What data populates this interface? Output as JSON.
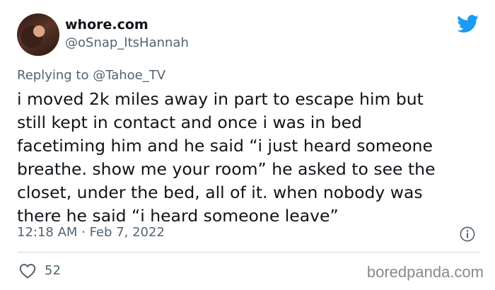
{
  "tweet": {
    "display_name": "whore.com",
    "handle": "@oSnap_ItsHannah",
    "replying_prefix": "Replying to",
    "replying_to": "@Tahoe_TV",
    "text_lines": [
      "i moved 2k miles away in part to escape him but",
      "still kept in contact and once i was in bed",
      "facetiming him and he said “i just heard someone",
      "breathe. show me your room” he asked to see the",
      "closet, under the bed, all of it. when nobody was",
      "there he said “i heard someone leave”"
    ],
    "timestamp": "12:18 AM · Feb 7, 2022",
    "likes": "52"
  },
  "colors": {
    "twitter_blue": "#1d9bf0",
    "text_secondary": "#536471"
  },
  "icons": [
    "twitter-bird-icon",
    "info-icon",
    "heart-icon"
  ],
  "watermark": "boredpanda.com"
}
